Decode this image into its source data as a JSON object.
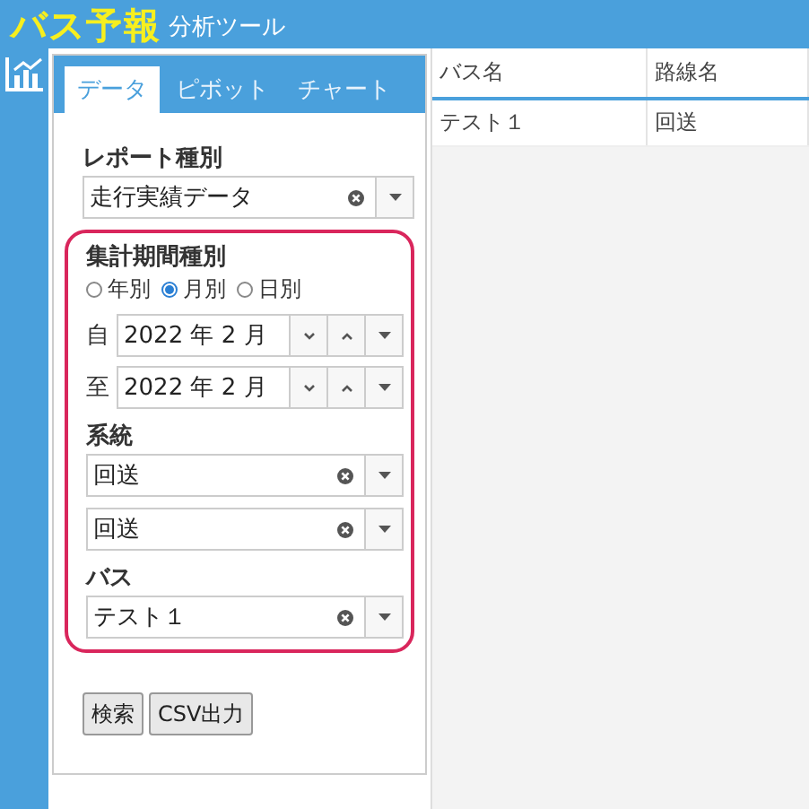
{
  "header": {
    "logo": "バス予報",
    "subtitle": "分析ツール"
  },
  "tabs": [
    {
      "label": "データ",
      "selected": true
    },
    {
      "label": "ピボット",
      "selected": false
    },
    {
      "label": "チャート",
      "selected": false
    }
  ],
  "report_type": {
    "label": "レポート種別",
    "value": "走行実績データ"
  },
  "period": {
    "label": "集計期間種別",
    "options": [
      {
        "label": "年別",
        "selected": false
      },
      {
        "label": "月別",
        "selected": true
      },
      {
        "label": "日別",
        "selected": false
      }
    ],
    "from": {
      "label": "自",
      "value": "2022 年 2 月"
    },
    "to": {
      "label": "至",
      "value": "2022 年 2 月"
    }
  },
  "route": {
    "label": "系統",
    "selects": [
      {
        "value": "回送"
      },
      {
        "value": "回送"
      }
    ]
  },
  "bus": {
    "label": "バス",
    "value": "テスト１"
  },
  "buttons": [
    "検索",
    "CSV出力"
  ],
  "table": {
    "columns": [
      "バス名",
      "路線名"
    ],
    "rows": [
      [
        "テスト１",
        "回送"
      ]
    ]
  }
}
